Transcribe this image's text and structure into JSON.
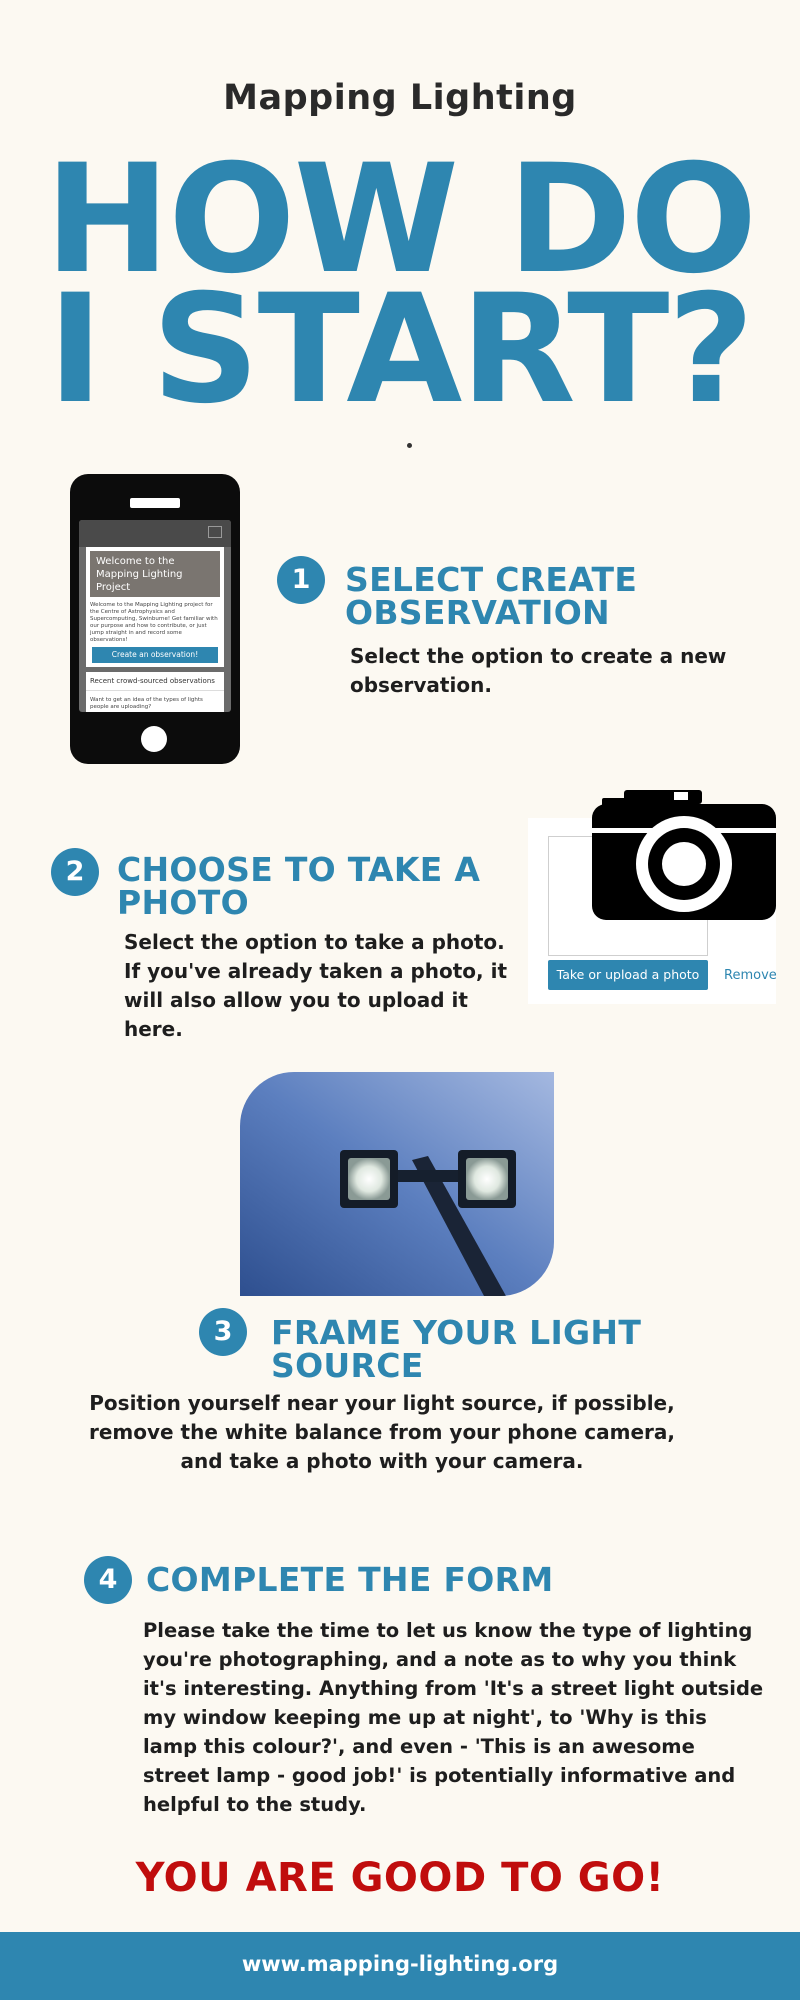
{
  "header": {
    "subtitle": "Mapping Lighting",
    "headline_line1": "HOW DO",
    "headline_line2": "I START?"
  },
  "phone_screen": {
    "welcome_line1": "Welcome to the",
    "welcome_line2": "Mapping Lighting",
    "welcome_line3": "Project",
    "intro_text": "Welcome to the Mapping Lighting project for the Centre of Astrophysics and Supercomputing, Swinburne! Get familiar with our purpose and how to contribute, or just jump straight in and record some observations!",
    "create_button": "Create an observation!",
    "recent_heading": "Recent crowd-sourced observations",
    "recent_text": "Want to get an idea of the types of lights people are uploading?"
  },
  "upload_widget": {
    "button_label": "Take or upload a photo",
    "remove_label": "Remove"
  },
  "steps": [
    {
      "number": "1",
      "title_line1": "SELECT CREATE",
      "title_line2": "OBSERVATION",
      "text_lines": [
        "Select the option to create a new",
        "observation."
      ]
    },
    {
      "number": "2",
      "title_line1": "CHOOSE TO TAKE A",
      "title_line2": "PHOTO",
      "text_lines": [
        "Select the option to take a photo.",
        "If you've already taken a photo, it",
        "will also allow you to upload it",
        "here."
      ]
    },
    {
      "number": "3",
      "title_line1": "FRAME YOUR LIGHT",
      "title_line2": "SOURCE",
      "text_lines": [
        "Position yourself near your light source, if possible,",
        "remove the white balance from your phone camera,",
        "and take a photo with your camera."
      ]
    },
    {
      "number": "4",
      "title_line1": "COMPLETE THE FORM",
      "text_lines": [
        "Please take the time to let us know the type of lighting",
        "you're photographing, and a note as to why you think",
        "it's interesting. Anything from 'It's a street light outside",
        "my window keeping me up at night', to 'Why is this",
        "lamp this colour?', and even - 'This is an awesome",
        "street lamp - good job!' is potentially informative and",
        "helpful to the study."
      ]
    }
  ],
  "final_message": "YOU ARE GOOD TO GO!",
  "footer": {
    "url": "www.mapping-lighting.org"
  },
  "icons": {
    "phone": "smartphone-icon",
    "camera": "camera-icon"
  },
  "colors": {
    "background": "#fcf9f2",
    "accent_blue": "#2e86b0",
    "final_red": "#c00d0d"
  }
}
